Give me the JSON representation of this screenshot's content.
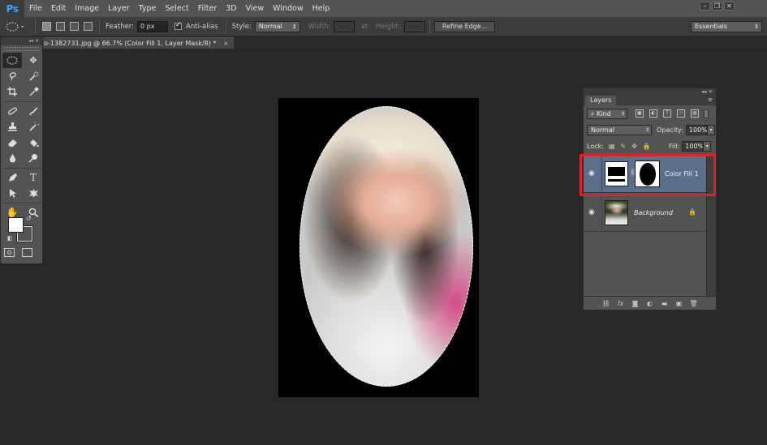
{
  "app": {
    "logo": "Ps"
  },
  "menu": [
    "File",
    "Edit",
    "Image",
    "Layer",
    "Type",
    "Select",
    "Filter",
    "3D",
    "View",
    "Window",
    "Help"
  ],
  "window_controls": [
    "–",
    "❐",
    "✕"
  ],
  "options": {
    "feather_label": "Feather:",
    "feather_value": "0 px",
    "antialias_label": "Anti-alias",
    "style_label": "Style:",
    "style_value": "Normal",
    "width_label": "Width:",
    "height_label": "Height:",
    "refine_edge": "Refine Edge...",
    "workspace": "Essentials"
  },
  "document": {
    "tab_title": "o-1382731.jpg @ 66.7% (Color Fill 1, Layer Mask/8) *",
    "tab_close": "×"
  },
  "toolbox": {
    "header": "◂◂ ✕",
    "tools": [
      "elliptical-marquee",
      "move",
      "lasso",
      "quick-selection",
      "crop",
      "eyedropper",
      "spot-healing-brush",
      "brush",
      "clone-stamp",
      "history-brush",
      "eraser",
      "paint-bucket",
      "blur",
      "dodge",
      "pen",
      "horizontal-type",
      "path-selection",
      "custom-shape",
      "hand",
      "zoom"
    ],
    "fg_color": "#ffffff",
    "bg_color": "#535353"
  },
  "layers_panel": {
    "header_controls": "◂◂ ✕",
    "tab_label": "Layers",
    "filter_kind": "Kind",
    "blend_mode": "Normal",
    "opacity_label": "Opacity:",
    "opacity_value": "100%",
    "lock_label": "Lock:",
    "fill_label": "Fill:",
    "fill_value": "100%",
    "layers": [
      {
        "name": "Color Fill 1",
        "selected": true,
        "highlighted": true
      },
      {
        "name": "Background",
        "selected": false,
        "locked": true
      }
    ],
    "footer_icons": [
      "link-icon",
      "fx-icon",
      "mask-icon",
      "adjustment-icon",
      "folder-icon",
      "new-layer-icon",
      "trash-icon"
    ]
  },
  "colors": {
    "highlight": "#e0202a",
    "selected_layer": "#5b6f8b",
    "ps_blue": "#31a8ff"
  }
}
